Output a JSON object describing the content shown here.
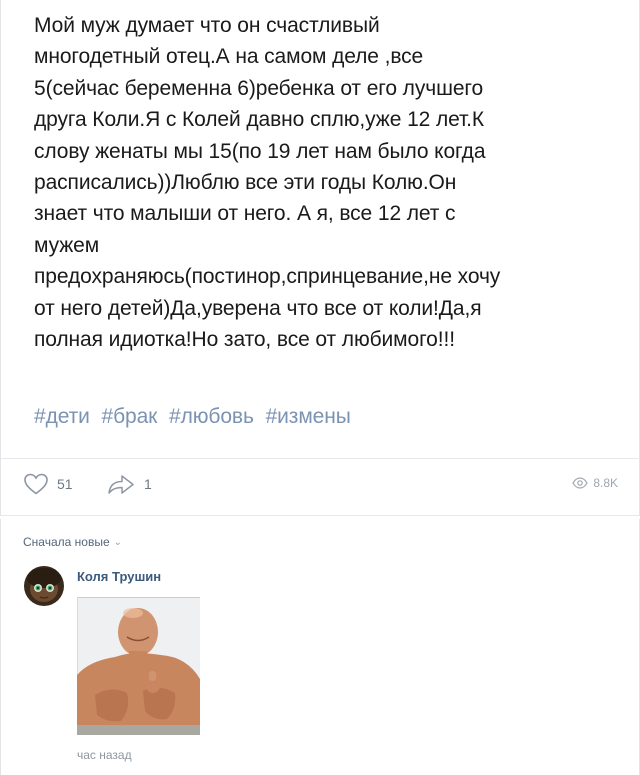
{
  "post": {
    "text": "Мой муж думает что он счастливый\nмногодетный отец.А на самом деле ,все\n5(сейчас беременна 6)ребенка от его лучшего\nдруга Коли.Я с Колей давно сплю,уже 12 лет.К\nслову женаты мы 15(по 19 лет нам было когда\nрасписались))Люблю все эти годы Колю.Он\nзнает что малыши от него. А я, все 12 лет с\nмужем\nпредохраняюсь(постинор,спринцевание,не хочу\nот него детей)Да,уверена что все от коли!Да,я\nполная идиотка!Но зато, все от любимого!!!",
    "hashtags": [
      "#дети",
      "#брак",
      "#любовь",
      "#измены"
    ]
  },
  "actions": {
    "likes": "51",
    "shares": "1",
    "views": "8.8K"
  },
  "comments": {
    "sort_label": "Сначала новые",
    "items": [
      {
        "author": "Коля Трушин",
        "time": "час назад"
      }
    ]
  },
  "colors": {
    "hashtag": "#7b93b3",
    "author": "#3b5a7e",
    "meta": "#828a99"
  }
}
